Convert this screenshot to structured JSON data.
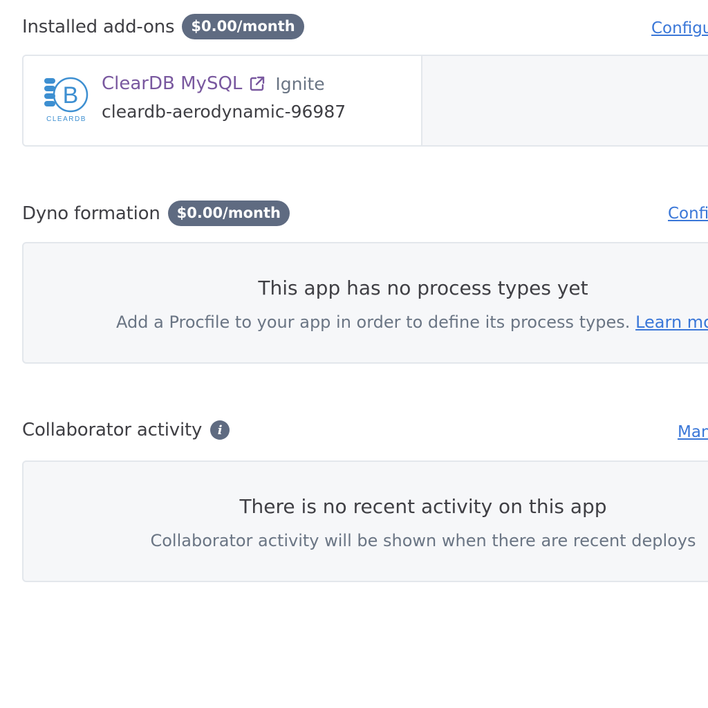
{
  "addons": {
    "title": "Installed add-ons",
    "cost": "$0.00/month",
    "link": "Configure Add-ons",
    "items": [
      {
        "logo_text": "CLEARDB",
        "logo_letter": "B",
        "name": "ClearDB MySQL",
        "plan": "Ignite",
        "instance": "cleardb-aerodynamic-96987"
      }
    ]
  },
  "dyno": {
    "title": "Dyno formation",
    "cost": "$0.00/month",
    "link": "Configure Dynos",
    "empty_title": "This app has no process types yet",
    "empty_text": "Add a Procfile to your app in order to define its process types.",
    "empty_link": "Learn more"
  },
  "activity": {
    "title": "Collaborator activity",
    "info_glyph": "i",
    "link": "Manage Access",
    "empty_title": "There is no recent activity on this app",
    "empty_text": "Collaborator activity will be shown when there are recent deploys"
  },
  "colors": {
    "badge": "#5f6b81",
    "link": "#3a77d8",
    "addon_name": "#79589f",
    "cleardb_blue": "#3d8fd1"
  }
}
